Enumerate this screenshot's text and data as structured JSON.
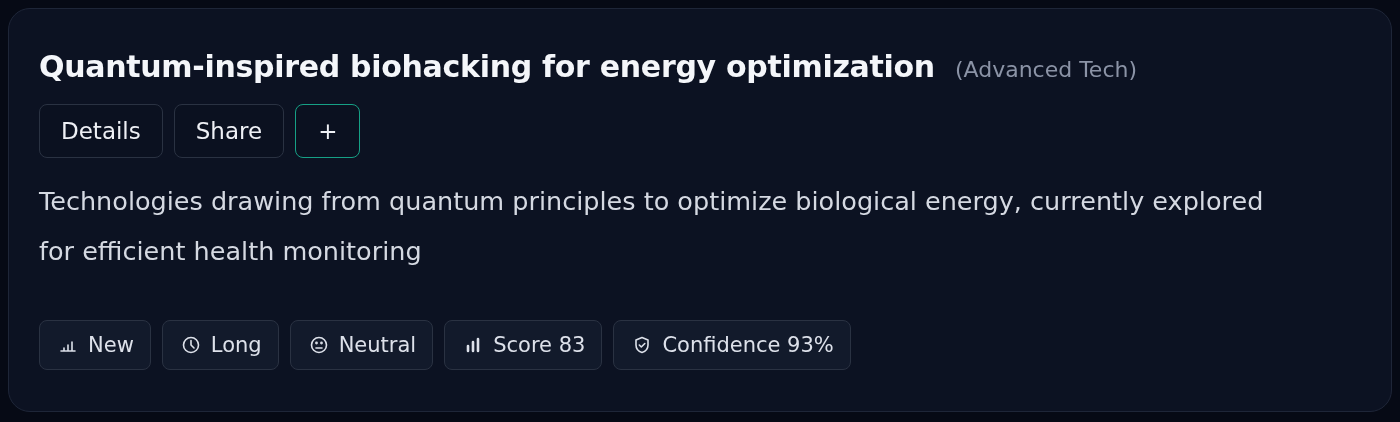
{
  "card": {
    "title": "Quantum-inspired biohacking for energy optimization",
    "category": "(Advanced Tech)",
    "buttons": [
      {
        "label": "Details",
        "kind": "plain"
      },
      {
        "label": "Share",
        "kind": "plain"
      },
      {
        "label": "+",
        "kind": "accent"
      }
    ],
    "description": "Technologies drawing from quantum principles to optimize biological energy, currently explored for efficient health monitoring",
    "chips": [
      {
        "kind": "signal-low",
        "label": "New"
      },
      {
        "kind": "clock",
        "label": "Long"
      },
      {
        "kind": "face",
        "label": "Neutral"
      },
      {
        "kind": "signal",
        "label": "Score 83"
      },
      {
        "kind": "shield",
        "label": "Confidence 93%"
      }
    ]
  }
}
